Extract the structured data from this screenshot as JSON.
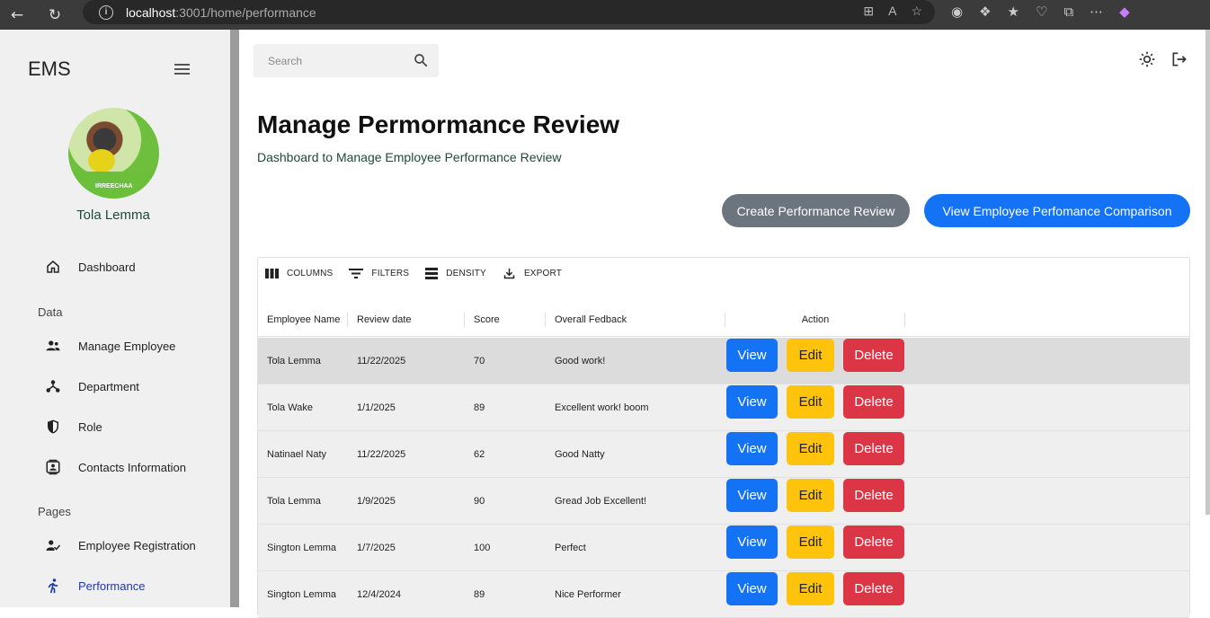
{
  "browser": {
    "url_host": "localhost",
    "url_path": ":3001/home/performance"
  },
  "sidebar": {
    "brand": "EMS",
    "user_name": "Tola Lemma",
    "avatar_text": "IRREECHAA",
    "items": [
      {
        "label": "Dashboard",
        "icon": "home-icon"
      },
      {
        "label": "Manage Employee",
        "icon": "people-icon"
      },
      {
        "label": "Department",
        "icon": "hierarchy-icon"
      },
      {
        "label": "Role",
        "icon": "shield-icon"
      },
      {
        "label": "Contacts Information",
        "icon": "contact-card-icon"
      },
      {
        "label": "Employee Registration",
        "icon": "person-check-icon"
      },
      {
        "label": "Performance",
        "icon": "runner-icon"
      }
    ],
    "sections": {
      "data": "Data",
      "pages": "Pages"
    }
  },
  "header": {
    "search_placeholder": "Search"
  },
  "page": {
    "title": "Manage Permormance Review",
    "subtitle": "Dashboard to Manage Employee Performance Review",
    "create_button": "Create Performance Review",
    "compare_button": "View Employee Perfomance Comparison"
  },
  "grid": {
    "toolbar": {
      "columns": "COLUMNS",
      "filters": "FILTERS",
      "density": "DENSITY",
      "export": "EXPORT"
    },
    "columns": [
      "Employee Name",
      "Review date",
      "Score",
      "Overall Fedback",
      "Action"
    ],
    "actions": {
      "view": "View",
      "edit": "Edit",
      "delete": "Delete"
    },
    "rows": [
      {
        "name": "Tola Lemma",
        "date": "11/22/2025",
        "score": "70",
        "feedback": "Good work!"
      },
      {
        "name": "Tola Wake",
        "date": "1/1/2025",
        "score": "89",
        "feedback": "Excellent work! boom"
      },
      {
        "name": "Natinael Naty",
        "date": "11/22/2025",
        "score": "62",
        "feedback": "Good Natty"
      },
      {
        "name": "Tola Lemma",
        "date": "1/9/2025",
        "score": "90",
        "feedback": "Gread Job Excellent!"
      },
      {
        "name": "Sington Lemma",
        "date": "1/7/2025",
        "score": "100",
        "feedback": "Perfect"
      },
      {
        "name": "Sington Lemma",
        "date": "12/4/2024",
        "score": "89",
        "feedback": "Nice Performer"
      }
    ]
  },
  "colors": {
    "primary": "#1472f5",
    "secondary": "#6c757d",
    "warning": "#ffc30b",
    "danger": "#dc3545"
  }
}
